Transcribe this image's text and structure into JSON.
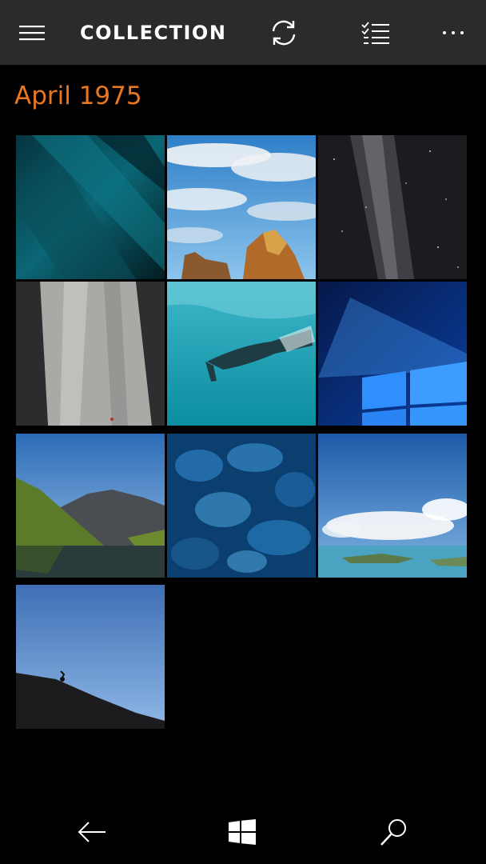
{
  "app_bar": {
    "title": "COLLECTION",
    "menu_icon": "hamburger-menu-icon",
    "sync_icon": "sync-icon",
    "select_icon": "multi-select-list-icon",
    "more_icon": "more-ellipsis-icon"
  },
  "section": {
    "header": "April 1975",
    "accent_color": "#e87722"
  },
  "photos": [
    {
      "subject": "abstract teal ribbons"
    },
    {
      "subject": "rock formation under blue sky"
    },
    {
      "subject": "milky way night sky"
    },
    {
      "subject": "climber on granite cliff"
    },
    {
      "subject": "underwater swimmer"
    },
    {
      "subject": "windows logo light"
    },
    {
      "subject": "mountain lake reflection"
    },
    {
      "subject": "blue ice cave"
    },
    {
      "subject": "islands under clouds"
    },
    {
      "subject": "cyclist silhouette on ridge"
    }
  ],
  "nav_bar": {
    "back_icon": "back-arrow-icon",
    "start_icon": "windows-start-icon",
    "search_icon": "search-icon"
  }
}
